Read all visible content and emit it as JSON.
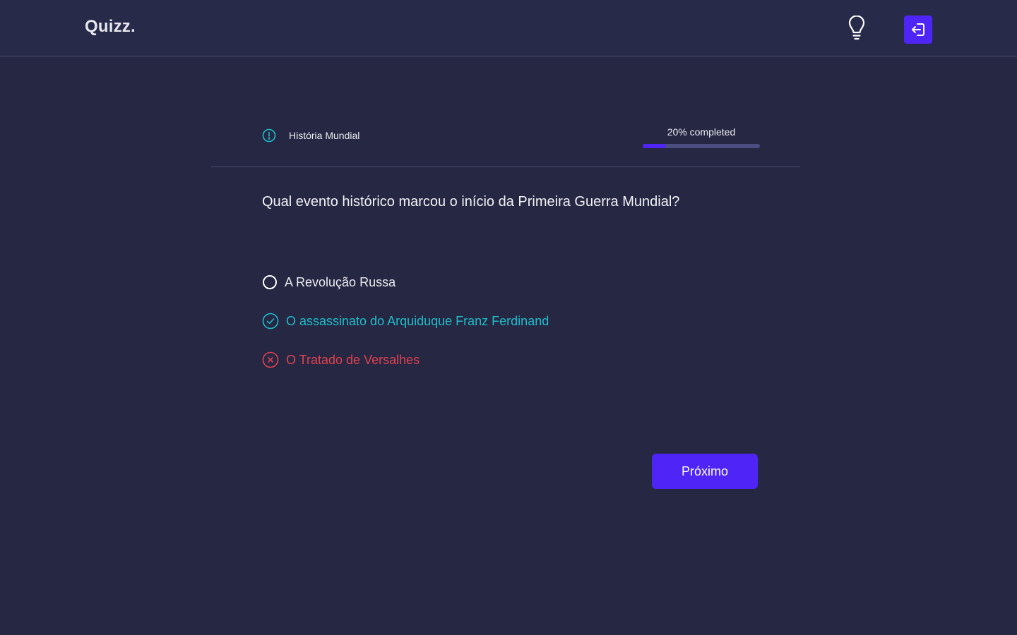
{
  "app": {
    "logo": "Quizz."
  },
  "header": {
    "hint_icon": "lightbulb-icon",
    "logout_icon": "logout-icon",
    "accent_color": "#4F25F7"
  },
  "quiz": {
    "category": "História Mundial",
    "category_icon": "info-icon",
    "progress": {
      "label": "20% completed",
      "percent": 20
    },
    "question": "Qual evento histórico marcou o início da Primeira Guerra Mundial?",
    "options": [
      {
        "label": "A Revolução Russa",
        "state": "unselected",
        "icon": "radio-empty-icon"
      },
      {
        "label": "O assassinato do Arquiduque Franz Ferdinand",
        "state": "correct",
        "icon": "check-circle-icon",
        "color": "#1FBDCB"
      },
      {
        "label": "O Tratado de Versalhes",
        "state": "wrong",
        "icon": "x-circle-icon",
        "color": "#E0424F"
      }
    ],
    "next_label": "Próximo"
  }
}
